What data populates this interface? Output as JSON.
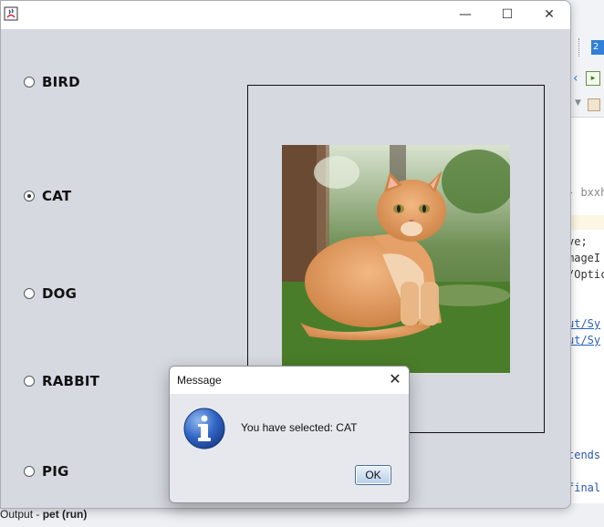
{
  "ide": {
    "tab_label": "2",
    "code_lines": [
      "bxxh",
      "ve;",
      "mageI",
      "/Optic",
      "ut/Sy",
      "ut/Sy",
      "tends",
      "final"
    ],
    "output_prefix": "Output - ",
    "output_project": "pet (run)"
  },
  "window": {
    "minimize_glyph": "—",
    "maximize_glyph": "☐",
    "close_glyph": "✕"
  },
  "radios": [
    {
      "label": "BIRD",
      "checked": false
    },
    {
      "label": "CAT",
      "checked": true
    },
    {
      "label": "DOG",
      "checked": false
    },
    {
      "label": "RABBIT",
      "checked": false
    },
    {
      "label": "PIG",
      "checked": false
    }
  ],
  "image": {
    "subject": "cat-photo"
  },
  "dialog": {
    "title": "Message",
    "close_glyph": "✕",
    "message": "You have selected: CAT",
    "ok_label": "OK",
    "icon": "info-icon"
  },
  "colors": {
    "frame_bg": "#d6d9e0",
    "dialog_bg": "#e6e8ee",
    "info_blue": "#2458b3",
    "ide_accent": "#2f80d6"
  }
}
